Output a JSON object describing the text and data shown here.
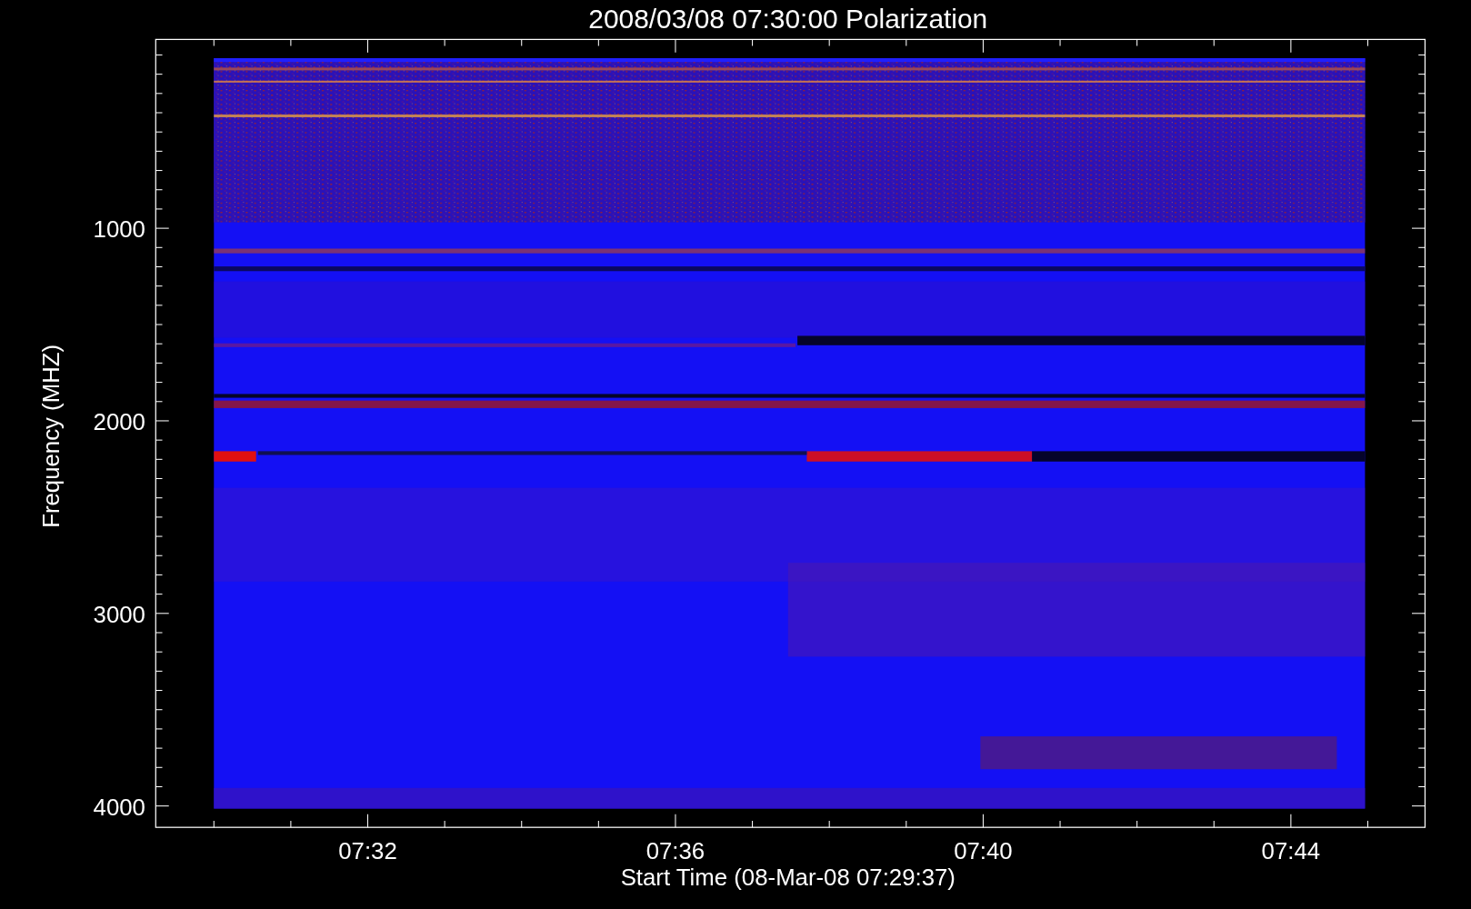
{
  "title": "2008/03/08 07:30:00 Polarization",
  "y_axis": {
    "label": "Frequency (MHZ)",
    "ticks": [
      "1000",
      "2000",
      "3000",
      "4000"
    ]
  },
  "x_axis": {
    "label": "Start Time (08-Mar-08 07:29:37)",
    "ticks": [
      "07:32",
      "07:36",
      "07:40",
      "07:44"
    ]
  }
}
